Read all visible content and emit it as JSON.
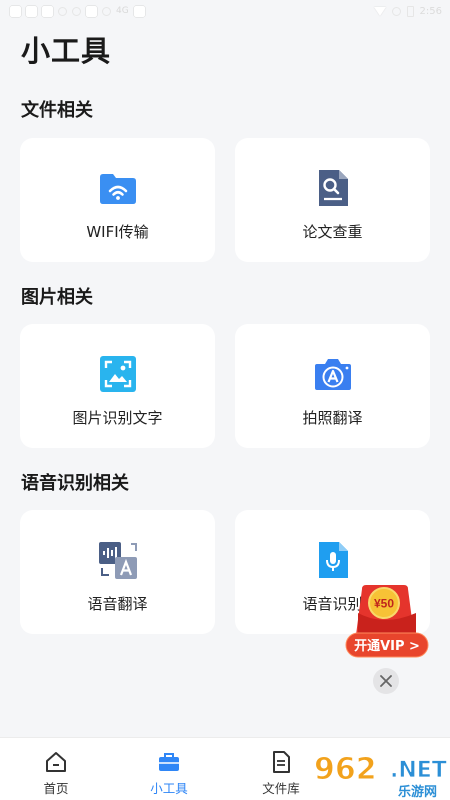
{
  "status_bar": {
    "network": "4G",
    "time": "2:56"
  },
  "page_title": "小工具",
  "sections": [
    {
      "title": "文件相关",
      "tools": [
        {
          "label": "WIFI传输",
          "icon": "wifi-folder-icon"
        },
        {
          "label": "论文查重",
          "icon": "document-search-icon"
        }
      ]
    },
    {
      "title": "图片相关",
      "tools": [
        {
          "label": "图片识别文字",
          "icon": "image-scan-icon"
        },
        {
          "label": "拍照翻译",
          "icon": "camera-translate-icon"
        }
      ]
    },
    {
      "title": "语音识别相关",
      "tools": [
        {
          "label": "语音翻译",
          "icon": "voice-translate-icon"
        },
        {
          "label": "语音识别",
          "icon": "voice-file-icon"
        }
      ]
    }
  ],
  "promo": {
    "amount": "¥50",
    "button_label": "开通VIP >"
  },
  "tabbar": {
    "active": "小工具",
    "accent_color": "#2f86f6",
    "items": [
      {
        "label": "首页",
        "icon": "home-icon"
      },
      {
        "label": "小工具",
        "icon": "toolbox-icon"
      },
      {
        "label": "文件库",
        "icon": "file-icon"
      }
    ]
  },
  "watermark": {
    "number": "962",
    "suffix": ".NET",
    "caption": "乐游网"
  }
}
